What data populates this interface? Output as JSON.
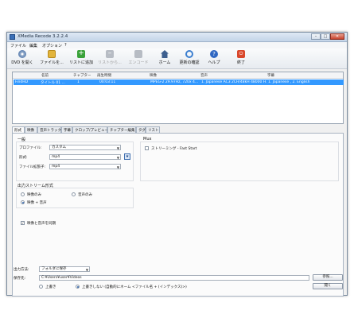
{
  "window": {
    "title": "XMedia Recode 3.2.2.4",
    "min": "–",
    "max": "□",
    "close": "✕"
  },
  "menu": [
    "ファイル",
    "編集",
    "オプション",
    "?"
  ],
  "toolbar": [
    {
      "label": "DVD を開く",
      "icon": "dvd-icon",
      "color": "#5b7fb0",
      "enabled": true
    },
    {
      "label": "ファイルを...",
      "icon": "folder-icon",
      "color": "#e2b43b",
      "enabled": true
    },
    {
      "label": "リストに追加",
      "icon": "plus-icon",
      "color": "#3aa23a",
      "enabled": true
    },
    {
      "label": "リストから...",
      "icon": "minus-icon",
      "color": "#b7bcc4",
      "enabled": false
    },
    {
      "label": "エンコード",
      "icon": "encode-icon",
      "color": "#b7bcc4",
      "enabled": false
    },
    {
      "label": "ホーム",
      "icon": "home-icon",
      "color": "#3d5f8f",
      "enabled": true
    },
    {
      "label": "更新の確認",
      "icon": "refresh-icon",
      "color": "#3c7fd0",
      "enabled": true
    },
    {
      "label": "ヘルプ",
      "icon": "help-icon",
      "color": "#2f67c2",
      "enabled": true
    },
    {
      "label": "終了",
      "icon": "exit-icon",
      "color": "#d9472b",
      "enabled": true
    }
  ],
  "list": {
    "columns": [
      "名前",
      "チャプター",
      "再生時間",
      "映像",
      "音声",
      "字幕"
    ],
    "rows": [
      [
        "FindHD",
        "タイトル 01 ...",
        "1",
        "00:03:11",
        "MPEG-2 29.97Hz, 720x 4...",
        "1. Japanese AC3 2CH/48kH 48000 H...",
        "1. Japanese , 2. English"
      ]
    ]
  },
  "tabs": [
    "形式",
    "映像",
    "音声トラック 1",
    "字幕",
    "クロップ/プレビュー",
    "チャプター編集",
    "タグ",
    "リスト"
  ],
  "format": {
    "general_header": "一般",
    "profile_label": "プロファイル:",
    "profile_value": "カスタム",
    "format_label": "形式:",
    "format_value": "mp4",
    "ext_label": "ファイル拡張子:",
    "ext_value": "mp4",
    "mux_header": "Mux",
    "mux_option": "ストリーミング - Fast Start",
    "stream_header": "出力ストリーム形式",
    "video_only": "映像のみ",
    "audio_only": "音声のみ",
    "video_audio": "映像 + 音声",
    "sync_label": "映像と音声を同期"
  },
  "bottom": {
    "output_label": "出力方法:",
    "output_value": "フォルダに保存",
    "save_label": "保存先:",
    "save_path": "C:¥Users¥user¥Videos",
    "browse_label": "参照...",
    "open_label": "開く",
    "overwrite_label": "上書き",
    "no_overwrite_label": "上書きしない (自動的にネーム <ファイル名 + (インデックス)>)"
  }
}
